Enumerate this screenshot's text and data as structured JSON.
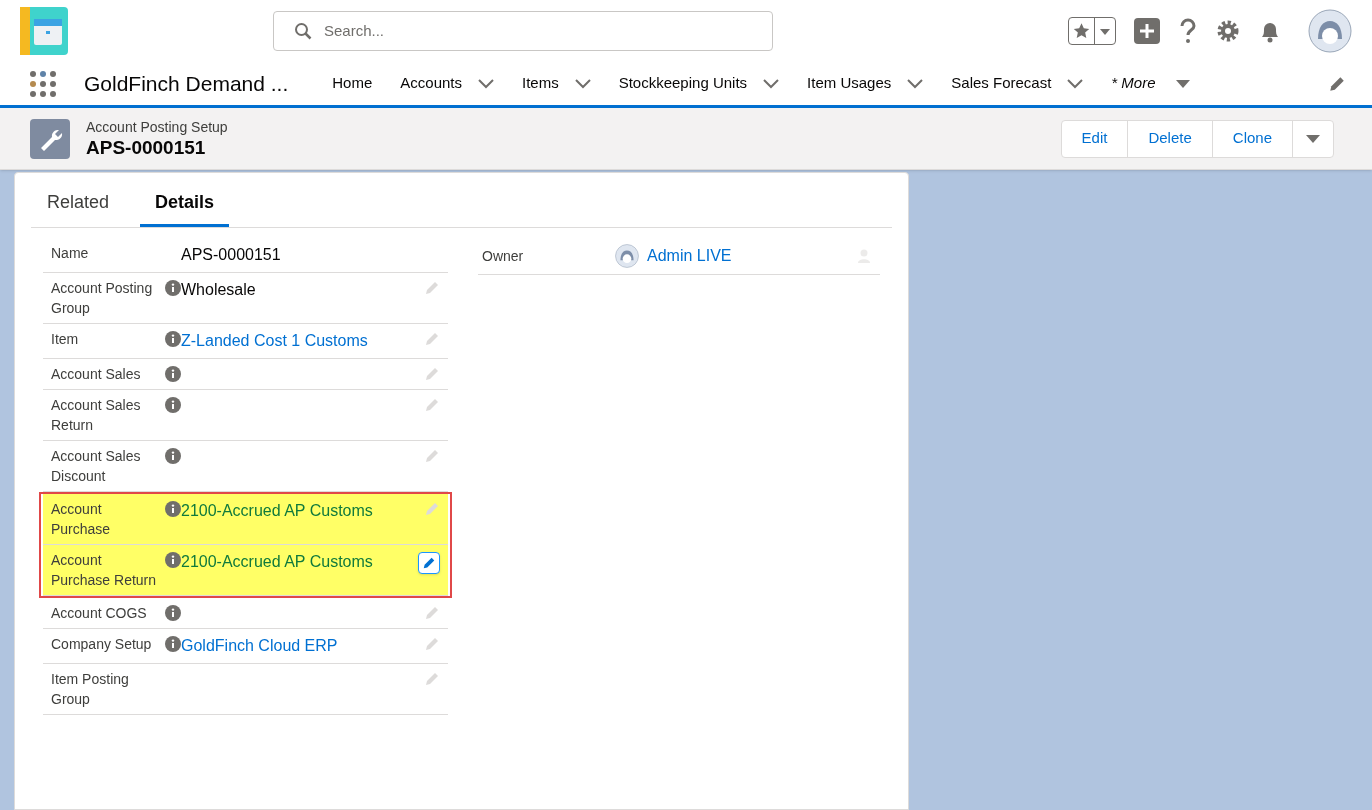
{
  "search": {
    "placeholder": "Search..."
  },
  "app": {
    "name": "GoldFinch Demand ..."
  },
  "nav": [
    {
      "label": "Home",
      "dropdown": false,
      "italic": false
    },
    {
      "label": "Accounts",
      "dropdown": true,
      "italic": false
    },
    {
      "label": "Items",
      "dropdown": true,
      "italic": false
    },
    {
      "label": "Stockkeeping Units",
      "dropdown": true,
      "italic": false
    },
    {
      "label": "Item Usages",
      "dropdown": true,
      "italic": false
    },
    {
      "label": "Sales Forecast",
      "dropdown": true,
      "italic": false
    },
    {
      "label": "* More",
      "dropdown": true,
      "italic": true
    }
  ],
  "record": {
    "object": "Account Posting Setup",
    "title": "APS-0000151"
  },
  "actions": [
    "Edit",
    "Delete",
    "Clone"
  ],
  "tabs": [
    {
      "label": "Related",
      "selected": false
    },
    {
      "label": "Details",
      "selected": true
    }
  ],
  "fields": [
    {
      "label": "Name",
      "value": "APS-0000151",
      "kind": "text",
      "info": false,
      "editable": false,
      "highlighted": false
    },
    {
      "label": "Account Posting Group",
      "value": "Wholesale",
      "kind": "text",
      "info": true,
      "editable": true,
      "highlighted": false,
      "edit_active": false
    },
    {
      "label": "Item",
      "value": "Z-Landed Cost 1 Customs",
      "kind": "link",
      "info": true,
      "editable": true,
      "highlighted": false,
      "edit_active": false
    },
    {
      "label": "Account Sales",
      "info": true,
      "editable": true,
      "highlighted": false,
      "edit_active": false
    },
    {
      "label": "Account Sales Return",
      "info": true,
      "editable": true,
      "highlighted": false,
      "edit_active": false
    },
    {
      "label": "Account Sales Discount",
      "info": true,
      "editable": true,
      "highlighted": false,
      "edit_active": false
    },
    {
      "label": "Account Purchase",
      "value": "2100-Accrued AP Customs",
      "kind": "link",
      "info": true,
      "editable": true,
      "highlighted": true,
      "edit_active": false
    },
    {
      "label": "Account Purchase Return",
      "value": "2100-Accrued AP Customs",
      "kind": "link",
      "info": true,
      "editable": true,
      "highlighted": true,
      "edit_active": true
    },
    {
      "label": "Account COGS",
      "info": true,
      "editable": true,
      "highlighted": false,
      "edit_active": false
    },
    {
      "label": "Company Setup",
      "value": "GoldFinch Cloud ERP",
      "kind": "link",
      "info": true,
      "editable": true,
      "highlighted": false,
      "edit_active": false
    },
    {
      "label": "Item Posting Group",
      "info": false,
      "editable": true,
      "highlighted": false,
      "edit_active": false
    }
  ],
  "owner": {
    "label": "Owner",
    "value": "Admin LIVE"
  }
}
